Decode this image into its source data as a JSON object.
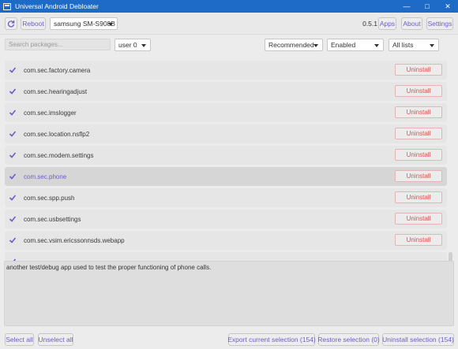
{
  "window": {
    "title": "Universal Android Debloater",
    "controls": [
      "minimize-icon",
      "maximize-icon",
      "close-icon"
    ]
  },
  "toolbar": {
    "refresh_icon": "refresh-icon",
    "reboot_label": "Reboot",
    "device": "samsung SM-S908B",
    "version": "0.5.1",
    "apps_label": "Apps",
    "about_label": "About",
    "settings_label": "Settings"
  },
  "filters": {
    "search_placeholder": "Search packages...",
    "user": "user 0",
    "recommendation": "Recommended",
    "state": "Enabled",
    "list": "All lists"
  },
  "packages": [
    {
      "name": "com.sec.factory.camera",
      "checked": true,
      "selected": false,
      "action": "Uninstall"
    },
    {
      "name": "com.sec.hearingadjust",
      "checked": true,
      "selected": false,
      "action": "Uninstall"
    },
    {
      "name": "com.sec.imslogger",
      "checked": true,
      "selected": false,
      "action": "Uninstall"
    },
    {
      "name": "com.sec.location.nsflp2",
      "checked": true,
      "selected": false,
      "action": "Uninstall"
    },
    {
      "name": "com.sec.modem.settings",
      "checked": true,
      "selected": false,
      "action": "Uninstall"
    },
    {
      "name": "com.sec.phone",
      "checked": true,
      "selected": true,
      "action": "Uninstall"
    },
    {
      "name": "com.sec.spp.push",
      "checked": true,
      "selected": false,
      "action": "Uninstall"
    },
    {
      "name": "com.sec.usbsettings",
      "checked": true,
      "selected": false,
      "action": "Uninstall"
    },
    {
      "name": "com.sec.vsim.ericssonnsds.webapp",
      "checked": true,
      "selected": false,
      "action": "Uninstall"
    },
    {
      "name": "",
      "checked": true,
      "selected": false,
      "action": ""
    }
  ],
  "description": "another test/debug app used to test the proper functioning of phone calls.",
  "bottom": {
    "select_all": "Select all",
    "unselect_all": "Unselect all",
    "export": "Export current selection (154)",
    "restore": "Restore selection (0)",
    "uninstall_selection": "Uninstall selection (154)"
  },
  "colors": {
    "titlebar": "#1e6bc7",
    "accent": "#6a5fc8",
    "danger": "#d9534f"
  }
}
